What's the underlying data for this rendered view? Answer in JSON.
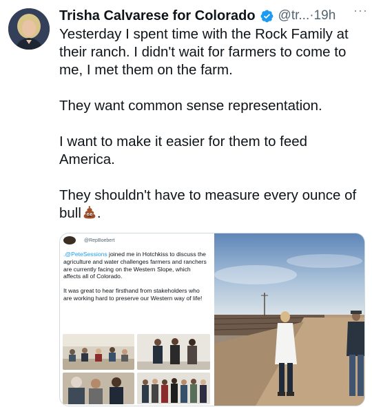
{
  "author": {
    "name": "Trisha Calvarese for Colorado",
    "handle": "@tr...",
    "time": "19h",
    "separator": "·",
    "more": "···"
  },
  "tweet": {
    "paragraphs": [
      "Yesterday I spent time with the Rock Family at their ranch. I didn't wait for farmers to come to me, I met them on the farm.",
      "They want common sense representation.",
      "I want to make it easier for them to feed America.",
      "They shouldn't have to measure every ounce of"
    ],
    "last_line_start": "bull",
    "last_line_end": ".",
    "emoji": "poop-emoji"
  },
  "quoted": {
    "handle": "@RepBoebert",
    "mention": ".@PeteSessions",
    "text_1": " joined me in Hotchkiss to discuss the agriculture and water challenges farmers and ranchers are currently facing on the Western Slope, which affects all of Colorado.",
    "text_2": "It was great to hear firsthand from stakeholders who are working hard to preserve our Western way of life!"
  },
  "colors": {
    "accent": "#1d9bf0",
    "text": "#0f1419",
    "secondary": "#536471"
  }
}
